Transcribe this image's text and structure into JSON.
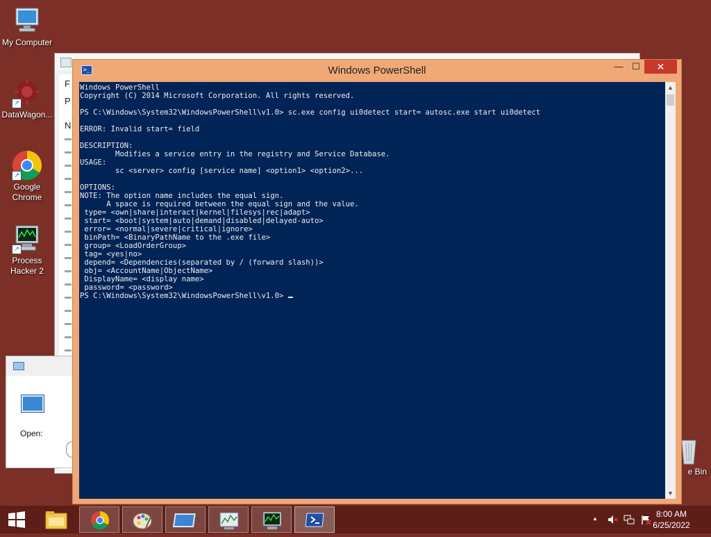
{
  "desktop": {
    "icons": [
      {
        "label": "My Computer"
      },
      {
        "label": "DataWagon..."
      },
      {
        "label": "Google Chrome"
      },
      {
        "label": "Process Hacker 2"
      },
      {
        "label": "e Bin"
      }
    ],
    "background_color": "#7b2f27"
  },
  "background_windows": {
    "left_window_letters": [
      "F",
      "P",
      "N"
    ],
    "run_dialog": {
      "open_label": "Open:"
    }
  },
  "powershell": {
    "title": "Windows PowerShell",
    "controls": {
      "minimize": "—",
      "maximize": "☐",
      "close": "✕"
    },
    "colors": {
      "console_bg": "#012456",
      "console_fg": "#eeedf0",
      "titlebar": "#f0a876"
    },
    "output": "Windows PowerShell\nCopyright (C) 2014 Microsoft Corporation. All rights reserved.\n\nPS C:\\Windows\\System32\\WindowsPowerShell\\v1.0> sc.exe config ui0detect start= autosc.exe start ui0detect\n\nERROR: Invalid start= field\n\nDESCRIPTION:\n        Modifies a service entry in the registry and Service Database.\nUSAGE:\n        sc <server> config [service name] <option1> <option2>...\n\nOPTIONS:\nNOTE: The option name includes the equal sign.\n      A space is required between the equal sign and the value.\n type= <own|share|interact|kernel|filesys|rec|adapt>\n start= <boot|system|auto|demand|disabled|delayed-auto>\n error= <normal|severe|critical|ignore>\n binPath= <BinaryPathName to the .exe file>\n group= <LoadOrderGroup>\n tag= <yes|no>\n depend= <Dependencies(separated by / (forward slash))>\n obj= <AccountName|ObjectName>\n DisplayName= <display name>\n password= <password>",
    "prompt": "PS C:\\Windows\\System32\\WindowsPowerShell\\v1.0> "
  },
  "taskbar": {
    "items": [
      {
        "name": "file-explorer-icon"
      },
      {
        "name": "chrome-icon"
      },
      {
        "name": "paint-icon"
      },
      {
        "name": "run-dialog-icon"
      },
      {
        "name": "task-manager-icon"
      },
      {
        "name": "process-hacker-icon"
      },
      {
        "name": "powershell-icon"
      }
    ],
    "tray": {
      "show_hidden": "▲",
      "time": "8:00 AM",
      "date": "6/25/2022"
    }
  }
}
